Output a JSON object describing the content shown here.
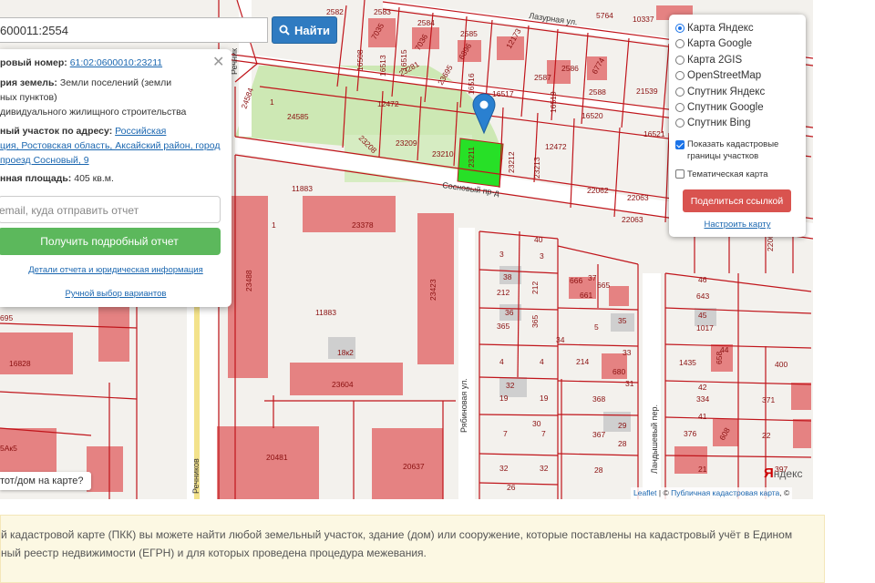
{
  "search": {
    "value": "600011:2554",
    "button_label": "Найти"
  },
  "popup": {
    "cadastral_label": "ровый номер:",
    "cadastral_value": "61:02:0600010:23211",
    "category_label": "рия земель:",
    "category_value_1": "Земли поселений (земли",
    "category_value_2": "ных пунктов)",
    "usage_value": "дивидуального жилищного строительства",
    "address_label": "ный участок по адресу:",
    "address_value_1": "Российская",
    "address_value_2": "ция, Ростовская область, Аксайский район, город",
    "address_value_3": "проезд Сосновый, 9",
    "area_label": "нная площадь:",
    "area_value": "405 кв.м.",
    "email_placeholder": "email, куда отправить отчет",
    "report_button": "Получить подробный отчет",
    "details_link": "Детали отчета и юридическая информация",
    "manual_link": "Ручной выбор вариантов"
  },
  "layers": {
    "options": [
      {
        "label": "Карта Яндекс",
        "selected": true
      },
      {
        "label": "Карта Google",
        "selected": false
      },
      {
        "label": "Карта 2GIS",
        "selected": false
      },
      {
        "label": "OpenStreetMap",
        "selected": false
      },
      {
        "label": "Спутник Яндекс",
        "selected": false
      },
      {
        "label": "Спутник Google",
        "selected": false
      },
      {
        "label": "Спутник Bing",
        "selected": false
      }
    ],
    "show_cadastral_1": "Показать кадастровые",
    "show_cadastral_2": "границы участков",
    "show_cadastral_checked": true,
    "thematic_label": "Тематическая карта",
    "thematic_checked": false,
    "share_button": "Поделиться ссылкой",
    "setup_link": "Настроить карту"
  },
  "map": {
    "question_button": "тот/дом на карте?",
    "yandex_logo_y": "Я",
    "yandex_logo_rest": "ндекс",
    "attribution_leaflet": "Leaflet",
    "attribution_sep": " | © ",
    "attribution_pkk": "Публичная кадастровая карта",
    "attribution_end": ", ©",
    "streets": {
      "sosnovy": "Сосновый пр-д",
      "lazurnaya": "Лазурная ул.",
      "rechnikov": "Речников",
      "ryabinovaya": "Рябиновая ул.",
      "landyshevy": "Ландышевый пер.",
      "rechnikov_top": "Речник"
    },
    "labels": {
      "l1": "2582",
      "l2": "2583",
      "l3": "7035",
      "l4": "2584",
      "l5": "7036",
      "l6": "2585",
      "l7": "6896",
      "l8": "16508",
      "l9": "16513",
      "l10": "23281",
      "l11": "23695",
      "l12": "16516",
      "l13": "16517",
      "l14": "2587",
      "l15": "2588",
      "l16": "21539",
      "l17": "5764",
      "l18": "10337",
      "l19": "16520",
      "l20": "16521",
      "l21": "24585",
      "l22": "12472",
      "l23": "23208",
      "l24": "23209",
      "l25": "23210",
      "l26": "12472",
      "l27": "23212",
      "l28": "23213",
      "l29": "22062",
      "l30": "22063",
      "l31": "22063",
      "l32": "11883",
      "l33": "23378",
      "l34": "11883",
      "l35": "23488",
      "l36": "23423",
      "l37": "18к2",
      "l38": "23604",
      "l39": "20481",
      "l40": "20637",
      "l41": "16828",
      "l42": "5Ак5",
      "l43": "695",
      "l44": "3",
      "l45": "40",
      "l46": "3",
      "l47": "38",
      "l48": "212",
      "l49": "212",
      "l50": "36",
      "l51": "365",
      "l52": "365",
      "l53": "666",
      "l54": "37",
      "l55": "661",
      "l56": "665",
      "l57": "5",
      "l58": "35",
      "l59": "34",
      "l60": "33",
      "l61": "4",
      "l62": "4",
      "l63": "214",
      "l64": "680",
      "l65": "32",
      "l66": "19",
      "l67": "19",
      "l68": "368",
      "l69": "31",
      "l70": "30",
      "l71": "7",
      "l72": "7",
      "l73": "367",
      "l74": "29",
      "l75": "28",
      "l76": "32",
      "l77": "32",
      "l78": "28",
      "l79": "26",
      "l80": "46",
      "l81": "643",
      "l82": "45",
      "l83": "1017",
      "l84": "1435",
      "l85": "658",
      "l86": "44",
      "l87": "400",
      "l88": "42",
      "l89": "334",
      "l90": "371",
      "l91": "41",
      "l92": "376",
      "l93": "608",
      "l94": "22",
      "l95": "21",
      "l96": "397",
      "l97": "24584",
      "l98": "16519",
      "l99": "16515",
      "l100": "2586",
      "l101": "6774",
      "l102": "12173",
      "l103": "1",
      "l104": "1",
      "l105": "23211",
      "l106": "22064",
      "l107": "22067"
    }
  },
  "note": {
    "line1": "й кадастровой карте (ПКК) вы можете найти любой земельный участок, здание (дом) или сооружение, которые поставлены на кадастровый учёт в Едином",
    "line2": "ный реестр недвижимости (ЕГРН) и для которых проведена процедура межевания."
  },
  "colors": {
    "parcel_border": "#c0151b",
    "building": "#e58282",
    "green_area": "#cde8b4",
    "selected_parcel": "#27e027",
    "accent": "#2f7bc1",
    "report_button": "#5cb85c",
    "share_button": "#d9534f",
    "note_bg": "#fcf8e3"
  },
  "icons": {
    "search": "search-icon",
    "close": "close-icon",
    "marker": "map-marker-icon"
  }
}
